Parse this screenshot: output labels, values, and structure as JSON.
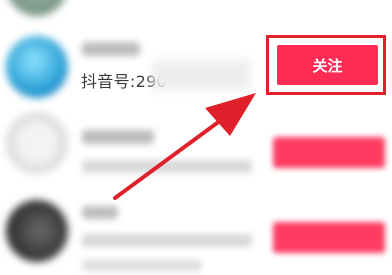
{
  "contact_list": {
    "featured": {
      "douyin_id_prefix": "抖音号:290",
      "follow_label": "关注"
    }
  },
  "colors": {
    "follow_button": "#fe2c55",
    "highlight": "#e0202a"
  },
  "icons": {
    "annotation": "arrow-pointing-to-follow-button"
  }
}
